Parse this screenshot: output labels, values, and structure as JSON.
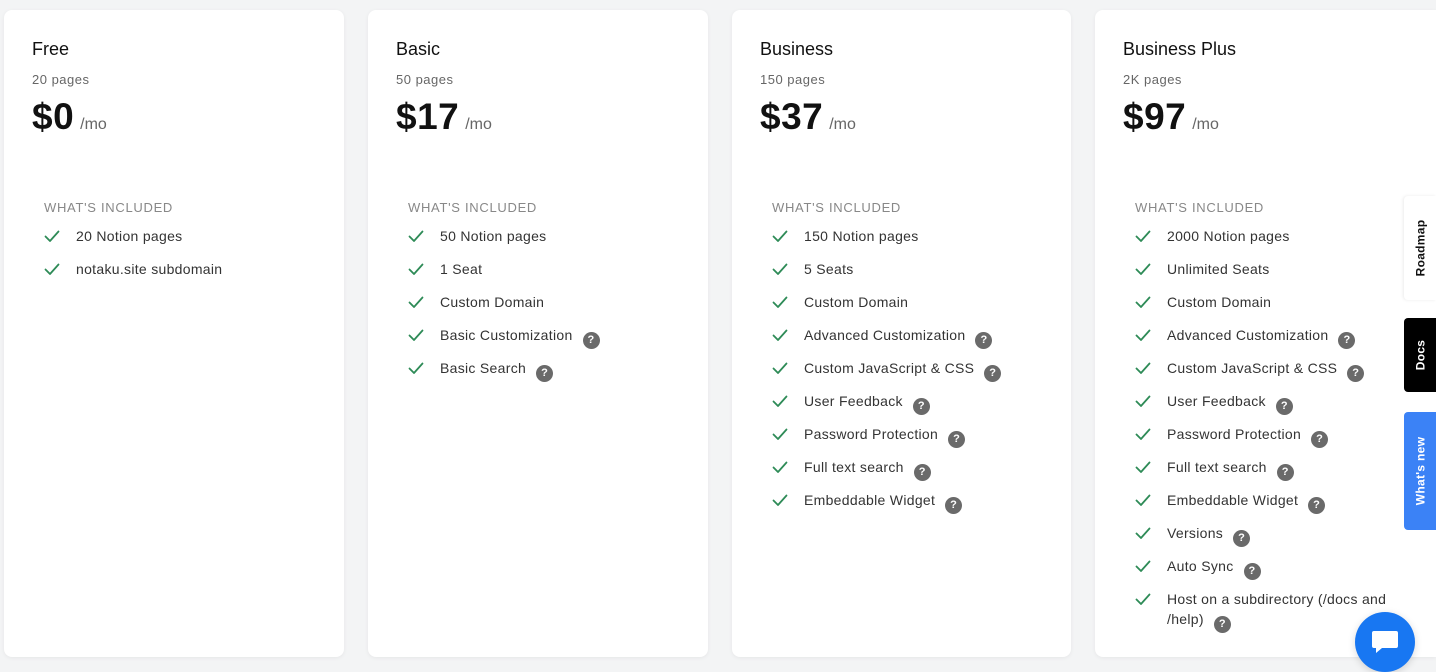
{
  "plans": [
    {
      "name": "Free",
      "pages": "20 pages",
      "price": "$0",
      "period": "/mo",
      "included_label": "WHAT'S INCLUDED",
      "features": [
        {
          "label": "20 Notion pages",
          "help": false
        },
        {
          "label": "notaku.site subdomain",
          "help": false
        }
      ]
    },
    {
      "name": "Basic",
      "pages": "50 pages",
      "price": "$17",
      "period": "/mo",
      "included_label": "WHAT'S INCLUDED",
      "features": [
        {
          "label": "50 Notion pages",
          "help": false
        },
        {
          "label": "1 Seat",
          "help": false
        },
        {
          "label": "Custom Domain",
          "help": false
        },
        {
          "label": "Basic Customization",
          "help": true
        },
        {
          "label": "Basic Search",
          "help": true
        }
      ]
    },
    {
      "name": "Business",
      "pages": "150 pages",
      "price": "$37",
      "period": "/mo",
      "included_label": "WHAT'S INCLUDED",
      "features": [
        {
          "label": "150 Notion pages",
          "help": false
        },
        {
          "label": "5 Seats",
          "help": false
        },
        {
          "label": "Custom Domain",
          "help": false
        },
        {
          "label": "Advanced Customization",
          "help": true
        },
        {
          "label": "Custom JavaScript & CSS",
          "help": true
        },
        {
          "label": "User Feedback",
          "help": true
        },
        {
          "label": "Password Protection",
          "help": true
        },
        {
          "label": "Full text search",
          "help": true
        },
        {
          "label": "Embeddable Widget",
          "help": true
        }
      ]
    },
    {
      "name": "Business Plus",
      "pages": "2K pages",
      "price": "$97",
      "period": "/mo",
      "included_label": "WHAT'S INCLUDED",
      "features": [
        {
          "label": "2000 Notion pages",
          "help": false
        },
        {
          "label": "Unlimited Seats",
          "help": false
        },
        {
          "label": "Custom Domain",
          "help": false
        },
        {
          "label": "Advanced Customization",
          "help": true
        },
        {
          "label": "Custom JavaScript & CSS",
          "help": true
        },
        {
          "label": "User Feedback",
          "help": true
        },
        {
          "label": "Password Protection",
          "help": true
        },
        {
          "label": "Full text search",
          "help": true
        },
        {
          "label": "Embeddable Widget",
          "help": true
        },
        {
          "label": "Versions",
          "help": true
        },
        {
          "label": "Auto Sync",
          "help": true
        },
        {
          "label": "Host on a subdirectory (/docs and /help)",
          "help": true
        }
      ]
    }
  ],
  "side_tabs": {
    "roadmap": "Roadmap",
    "docs": "Docs",
    "whats_new": "What's new"
  },
  "icons": {
    "check": "check-icon",
    "help": "question-circle-icon",
    "chat": "chat-bubble-icon"
  },
  "help_glyph": "?",
  "colors": {
    "check": "#2e8b57",
    "help_bg": "#6a6a6a",
    "docs_tab": "#000000",
    "whats_new_tab": "#3b82f6",
    "chat_button": "#1877f2"
  }
}
